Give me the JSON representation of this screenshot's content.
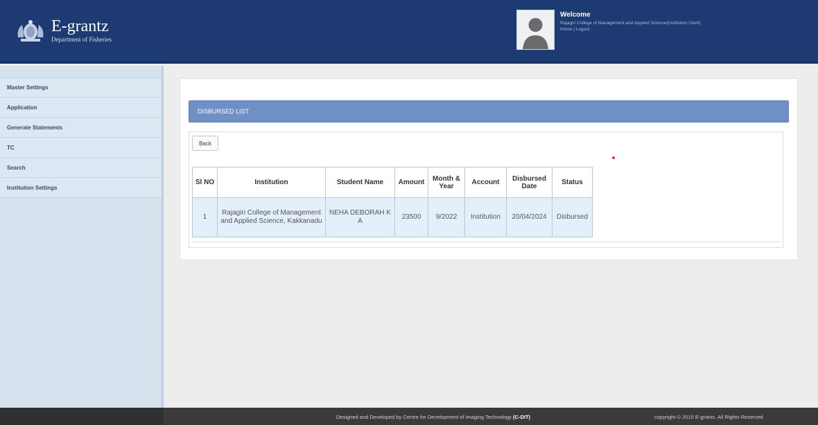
{
  "header": {
    "app_title": "E-grantz",
    "department": "Department of Fisheries",
    "welcome_title": "Welcome",
    "user_name": "Rajagiri College of Management and Applied Science(Institution Clerk)",
    "links": {
      "home": "Home",
      "separator": " | ",
      "logout": "Logout"
    }
  },
  "sidebar": {
    "items": [
      {
        "label": "Master Settings"
      },
      {
        "label": "Application"
      },
      {
        "label": "Generate Statements"
      },
      {
        "label": "TC"
      },
      {
        "label": "Search"
      },
      {
        "label": "Institution Settings"
      }
    ]
  },
  "main": {
    "panel_title": "DISBURSED LIST",
    "back_label": "Back",
    "table": {
      "columns": [
        "Sl NO",
        "Institution",
        "Student Name",
        "Amount",
        "Month & Year",
        "Account",
        "Disbursed Date",
        "Status"
      ],
      "rows": [
        [
          "1",
          "Rajagiri College of Management and Applied Science, Kakkanadu",
          "NEHA DEBORAH K A",
          "23500",
          "9/2022",
          "Institution",
          "20/04/2024",
          "Disbursed"
        ]
      ]
    }
  },
  "footer": {
    "credit_text": "Designed and Developed by Centre for Development of Imaging Technology ",
    "credit_org": "(C-DIT)",
    "copyright": "copyright © 2015 E-grants. All Rights Reserved"
  },
  "colors": {
    "header_bg": "#1e3a73",
    "panel_head_bg": "#6f90c5",
    "sidebar_bg": "#d6e1ee",
    "row_bg": "#e3f0fb",
    "footer_bg": "#3a3a3a"
  }
}
